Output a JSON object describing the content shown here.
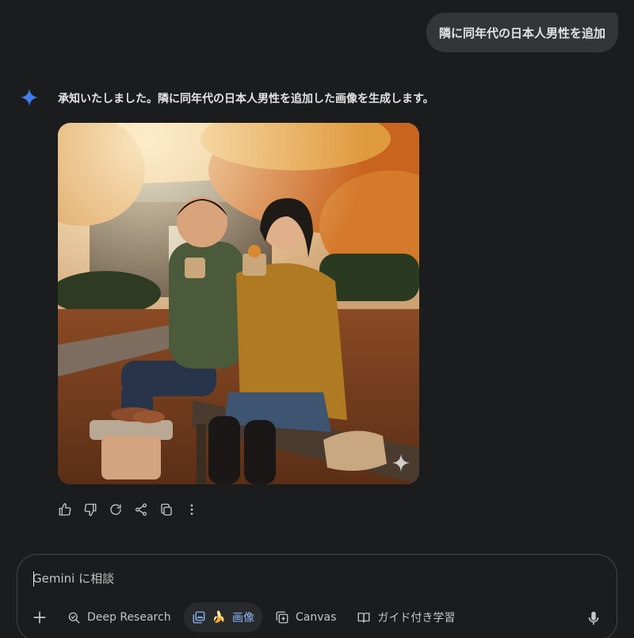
{
  "user_message": "隣に同年代の日本人男性を追加",
  "response": {
    "text": "承知いたしました。隣に同年代の日本人男性を追加した画像を生成します。",
    "icon": "gemini-spark-icon"
  },
  "image": {
    "description_icon": "generated-image",
    "watermark_icon": "sparkle-watermark-icon"
  },
  "actions": [
    {
      "name": "thumbs-up-icon"
    },
    {
      "name": "thumbs-down-icon"
    },
    {
      "name": "regenerate-icon"
    },
    {
      "name": "share-icon"
    },
    {
      "name": "copy-icon"
    },
    {
      "name": "more-vert-icon"
    }
  ],
  "composer": {
    "placeholder": "Gemini に相談",
    "plus_icon": "plus-icon",
    "tools": {
      "deep_research": "Deep Research",
      "image": "画像",
      "image_emoji": "🍌",
      "canvas": "Canvas",
      "guided": "ガイド付き学習"
    },
    "mic_icon": "mic-icon"
  },
  "colors": {
    "background": "#1b1c1d",
    "bubble": "#333537",
    "accent": "#8ab4f8",
    "border": "#444746"
  }
}
